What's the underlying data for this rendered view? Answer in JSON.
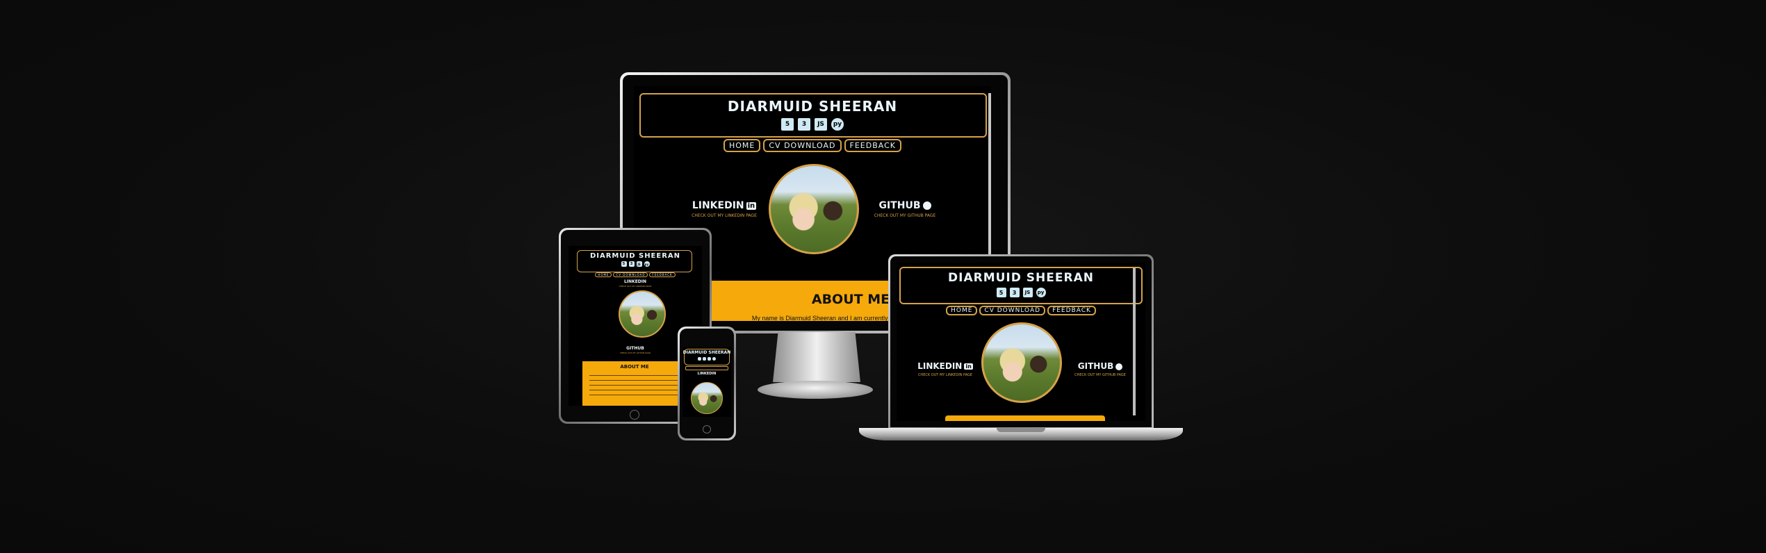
{
  "site": {
    "name": "DIARMUID SHEERAN",
    "icons": [
      "html5-icon",
      "css3-icon",
      "javascript-icon",
      "python-icon"
    ],
    "nav": [
      "HOME",
      "CV DOWNLOAD",
      "FEEDBACK"
    ],
    "linkedin_label": "LINKEDIN",
    "linkedin_sub": "CHECK OUT MY LINKEDIN PAGE",
    "github_label": "GITHUB",
    "github_sub": "CHECK OUT MY GITHUB PAGE",
    "about_title": "ABOUT ME",
    "about_text": "My name is Diarmuid Sheeran and I am currently a student of the Code"
  },
  "colors": {
    "background": "#0d0d0d",
    "accent": "#d5a24a",
    "about_bg": "#f5a90b",
    "text_light": "#eaf6fb"
  }
}
